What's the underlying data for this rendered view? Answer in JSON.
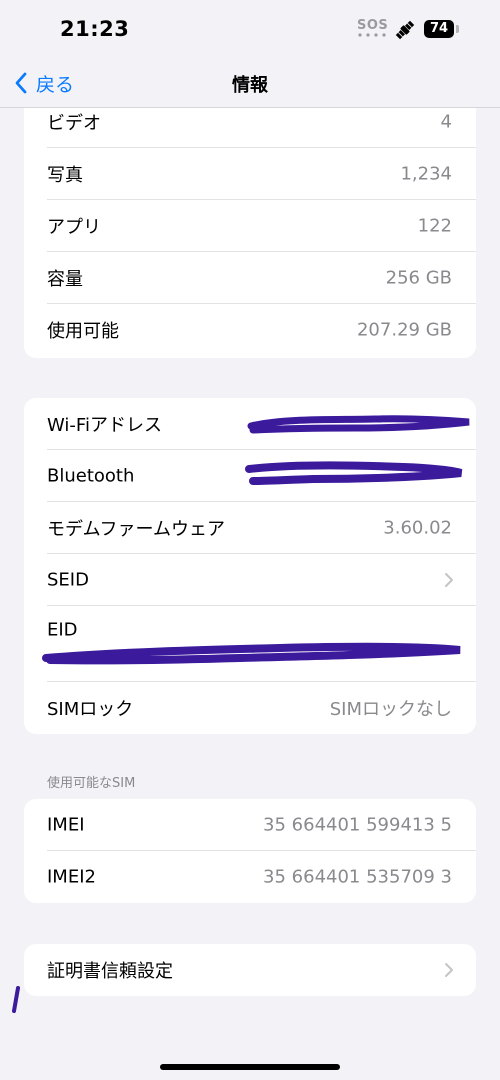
{
  "status_bar": {
    "time": "21:23",
    "sos": "SOS",
    "battery": "74"
  },
  "nav": {
    "back_label": "戻る",
    "title": "情報"
  },
  "group1": [
    {
      "label": "ビデオ",
      "value": "4"
    },
    {
      "label": "写真",
      "value": "1,234"
    },
    {
      "label": "アプリ",
      "value": "122"
    },
    {
      "label": "容量",
      "value": "256 GB"
    },
    {
      "label": "使用可能",
      "value": "207.29 GB"
    }
  ],
  "group2": {
    "wifi_label": "Wi-Fiアドレス",
    "bluetooth_label": "Bluetooth",
    "modem_label": "モデムファームウェア",
    "modem_value": "3.60.02",
    "seid_label": "SEID",
    "eid_label": "EID",
    "sim_lock_label": "SIMロック",
    "sim_lock_value": "SIMロックなし"
  },
  "sim_section": {
    "header": "使用可能なSIM",
    "imei_label": "IMEI",
    "imei_value": "35 664401 599413 5",
    "imei2_label": "IMEI2",
    "imei2_value": "35 664401 535709 3"
  },
  "group4": {
    "cert_label": "証明書信頼設定"
  },
  "colors": {
    "accent": "#0a7aff",
    "background": "#f2f2f7",
    "secondary_text": "#8a8a8e",
    "redaction": "#3b1a9c"
  }
}
